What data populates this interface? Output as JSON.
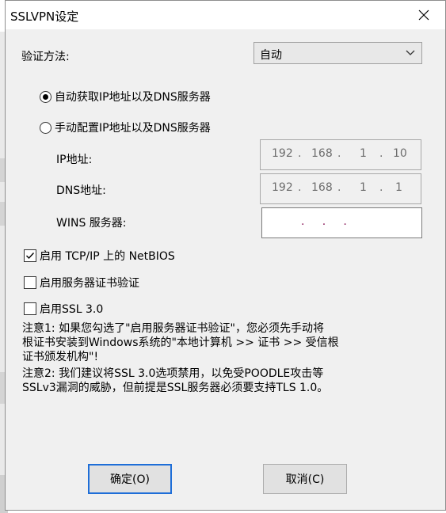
{
  "dialog": {
    "title": "SSLVPN设定",
    "close_glyph": "✕"
  },
  "auth": {
    "label": "验证方法:",
    "selected": "自动"
  },
  "ip_mode": {
    "auto_label": "自动获取IP地址以及DNS服务器",
    "manual_label": "手动配置IP地址以及DNS服务器",
    "selected": "auto"
  },
  "fields": {
    "ip_label": "IP地址:",
    "ip": [
      "192",
      "168",
      "1",
      "10"
    ],
    "dns_label": "DNS地址:",
    "dns": [
      "192",
      "168",
      "1",
      "1"
    ],
    "wins_label": "WINS 服务器:",
    "wins_dots": ".     .     ."
  },
  "options": {
    "netbios_label": "启用 TCP/IP 上的 NetBIOS",
    "netbios_checked": true,
    "cert_label": "启用服务器证书验证",
    "cert_checked": false,
    "ssl3_label": "启用SSL 3.0",
    "ssl3_checked": false
  },
  "notes": {
    "note1": "注意1: 如果您勾选了\"启用服务器证书验证\"，您必须先手动将\n根证书安装到Windows系统的\"本地计算机 >> 证书 >> 受信根\n证书颁发机构\"!",
    "note2": "注意2: 我们建议将SSL 3.0选项禁用，以免受POODLE攻击等\nSSLv3漏洞的威胁，但前提是SSL服务器必须要支持TLS 1.0。"
  },
  "buttons": {
    "ok_label": "确定(O)",
    "cancel_label": "取消(C)"
  },
  "colors": {
    "dialog_bg": "#f0f0f0",
    "default_button_border": "#1e6ed8",
    "disabled_text": "#6d6d6d"
  }
}
